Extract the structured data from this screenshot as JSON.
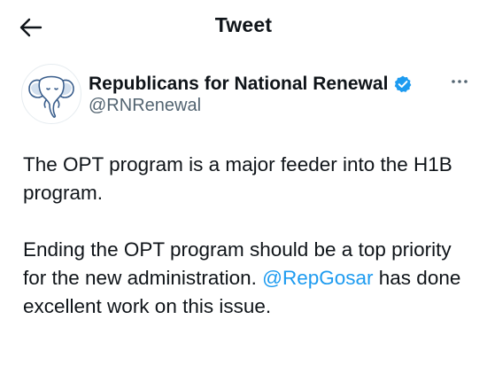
{
  "header": {
    "title": "Tweet",
    "back_icon": "arrow-left-icon"
  },
  "author": {
    "display_name": "Republicans for National Renewal",
    "handle": "@RNRenewal",
    "verified": true,
    "verified_color": "#1d9bf0",
    "avatar_icon": "elephant-logo-icon"
  },
  "tweet": {
    "paragraph1": "The OPT program is a major feeder into the H1B program.",
    "paragraph2_before": "Ending the OPT program should be a top priority for the new administration. ",
    "mention": "@RepGosar",
    "paragraph2_after": " has done excellent work on this issue."
  },
  "colors": {
    "text": "#0f1419",
    "secondary": "#536471",
    "link": "#1d9bf0"
  }
}
